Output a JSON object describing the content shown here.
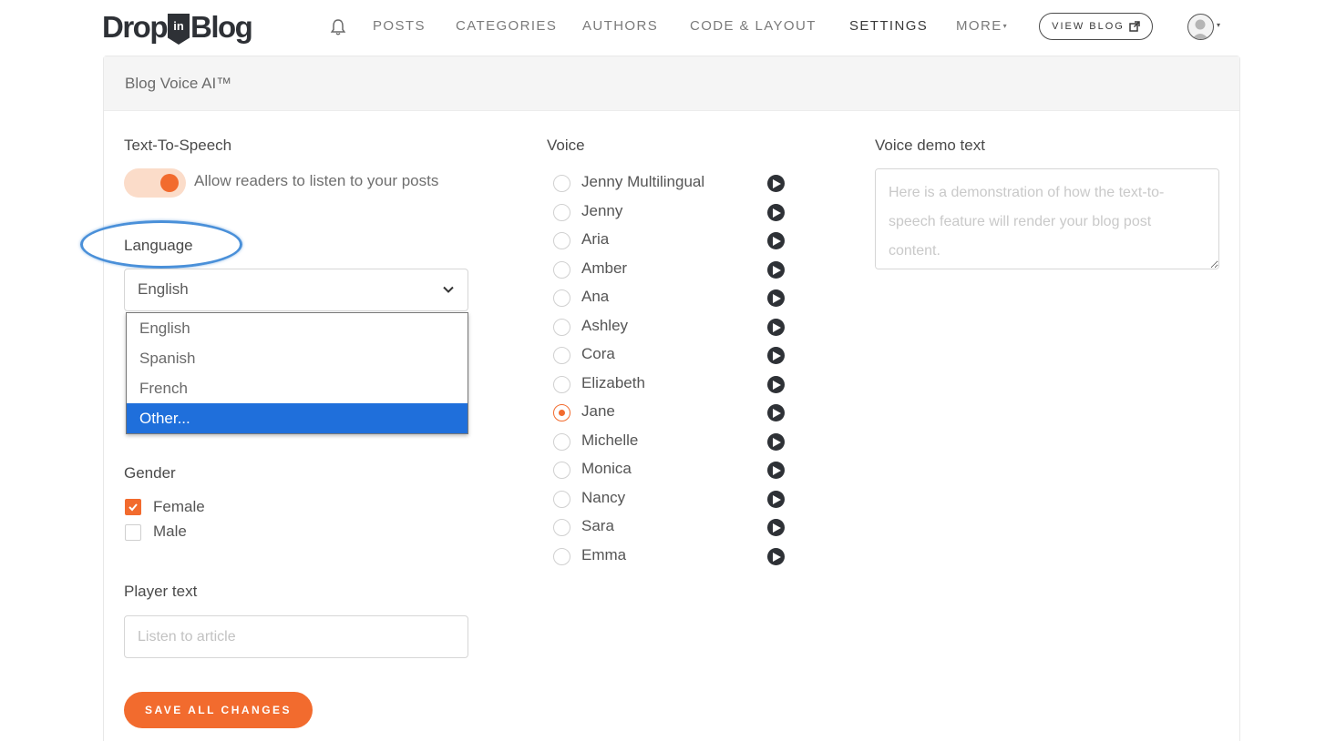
{
  "brand": {
    "logo_left": "Drop",
    "logo_badge": "in",
    "logo_right": "Blog"
  },
  "nav": {
    "items": [
      "POSTS",
      "CATEGORIES",
      "AUTHORS",
      "CODE & LAYOUT",
      "SETTINGS",
      "MORE"
    ],
    "active": "SETTINGS",
    "view_blog": "VIEW BLOG",
    "icons": {
      "notifications": "bell-icon",
      "external": "external-link-icon",
      "user": "user-avatar-icon"
    }
  },
  "card": {
    "title": "Blog Voice AI™"
  },
  "tts": {
    "label": "Text-To-Speech",
    "toggle_text": "Allow readers to listen to your posts",
    "enabled": true
  },
  "language": {
    "label": "Language",
    "selected": "English",
    "options": [
      "English",
      "Spanish",
      "French",
      "Other..."
    ],
    "highlighted": "Other..."
  },
  "gender": {
    "label": "Gender",
    "options": [
      {
        "label": "Female",
        "checked": true
      },
      {
        "label": "Male",
        "checked": false
      }
    ]
  },
  "player_text": {
    "label": "Player text",
    "placeholder": "Listen to article"
  },
  "save_label": "SAVE ALL CHANGES",
  "voice": {
    "label": "Voice",
    "selected": "Jane",
    "options": [
      "Jenny Multilingual",
      "Jenny",
      "Aria",
      "Amber",
      "Ana",
      "Ashley",
      "Cora",
      "Elizabeth",
      "Jane",
      "Michelle",
      "Monica",
      "Nancy",
      "Sara",
      "Emma"
    ]
  },
  "demo": {
    "label": "Voice demo text",
    "placeholder": "Here is a demonstration of how the text-to-speech feature will render your blog post content."
  },
  "colors": {
    "accent": "#f26b2e",
    "accent_light": "#fbdcc9",
    "highlight": "#1f6fdb",
    "annotation": "#4a90d9",
    "dark": "#2e3136"
  }
}
